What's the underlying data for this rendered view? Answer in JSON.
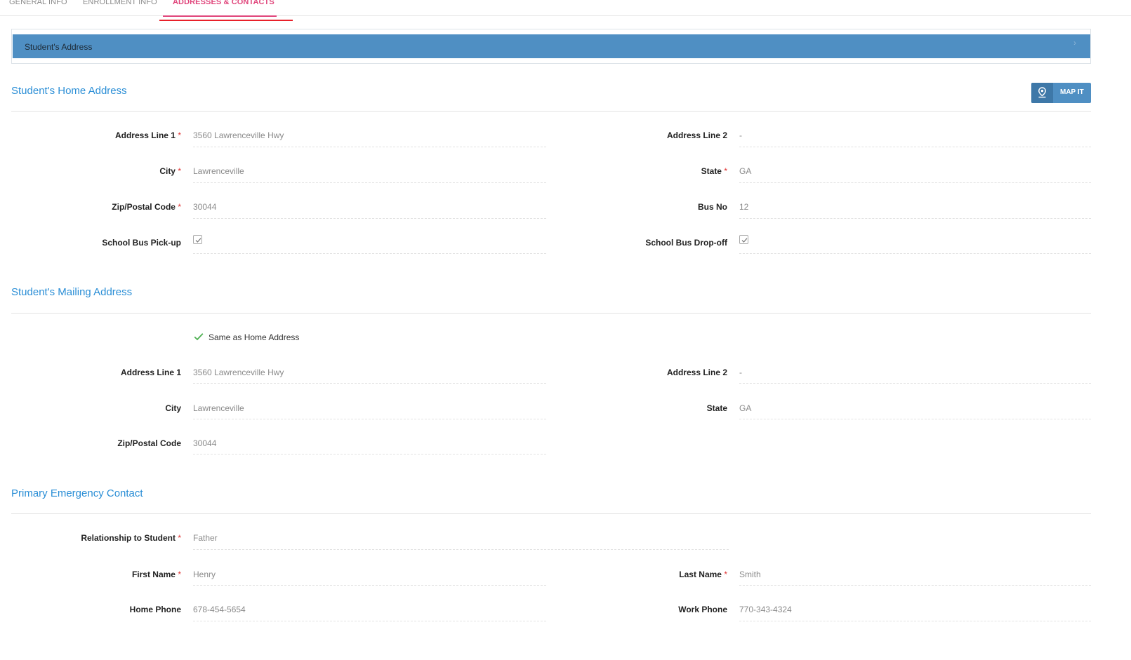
{
  "tabs": [
    {
      "label": "General Info"
    },
    {
      "label": "Enrollment Info"
    },
    {
      "label": "Addresses & Contacts",
      "active": true
    }
  ],
  "panel": {
    "title": "Student's Address",
    "chevron_icon": "chevron-right-icon"
  },
  "home": {
    "title": "Student's Home Address",
    "map_button": {
      "label": "MAP IT",
      "icon": "map-pin-icon"
    },
    "address1_label": "Address Line 1",
    "address1": "3560 Lawrenceville Hwy",
    "address2_label": "Address Line 2",
    "address2": "-",
    "city_label": "City",
    "city": "Lawrenceville",
    "state_label": "State",
    "state": "GA",
    "zip_label": "Zip/Postal Code",
    "zip": "30044",
    "bus_label": "Bus No",
    "bus": "12",
    "pickup_label": "School Bus Pick-up",
    "pickup_checked": true,
    "dropoff_label": "School Bus Drop-off",
    "dropoff_checked": true
  },
  "mailing": {
    "title": "Student's Mailing Address",
    "same_label": "Same as Home Address",
    "same_checked": true,
    "address1_label": "Address Line 1",
    "address1": "3560 Lawrenceville Hwy",
    "address2_label": "Address Line 2",
    "address2": "-",
    "city_label": "City",
    "city": "Lawrenceville",
    "state_label": "State",
    "state": "GA",
    "zip_label": "Zip/Postal Code",
    "zip": "30044"
  },
  "emergency": {
    "title": "Primary Emergency Contact",
    "relationship_label": "Relationship to Student",
    "relationship": "Father",
    "first_label": "First Name",
    "first": "Henry",
    "last_label": "Last Name",
    "last": "Smith",
    "home_phone_label": "Home Phone",
    "home_phone": "678-454-5654",
    "work_phone_label": "Work Phone",
    "work_phone": "770-343-4324"
  },
  "required_marker": "*",
  "colors": {
    "accent": "#e0457b",
    "header_bar": "#4f8fc3",
    "section_title": "#2a8ed6",
    "required": "#e03535",
    "check_green": "#4caf50"
  }
}
